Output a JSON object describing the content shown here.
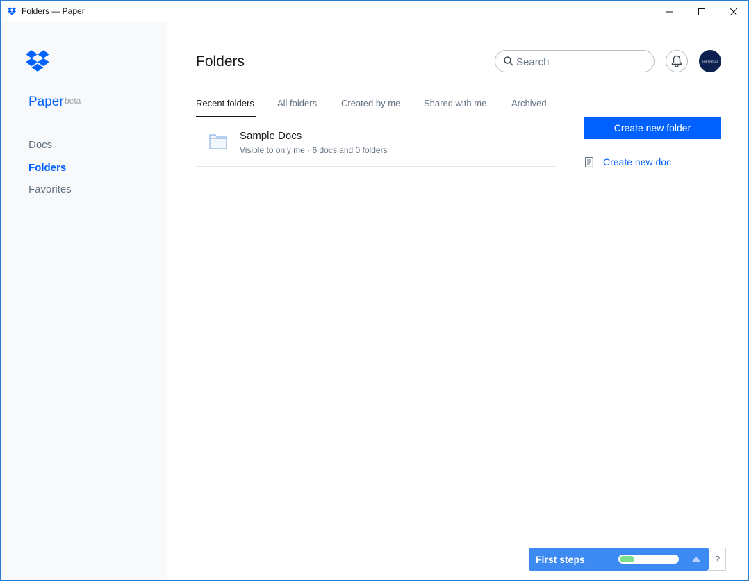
{
  "window": {
    "title": "Folders — Paper",
    "controls": [
      "minimize",
      "maximize",
      "close"
    ]
  },
  "sidebar": {
    "brand": "Paper",
    "brand_tag": "beta",
    "items": [
      {
        "label": "Docs",
        "active": false
      },
      {
        "label": "Folders",
        "active": true
      },
      {
        "label": "Favorites",
        "active": false
      }
    ]
  },
  "header": {
    "title": "Folders",
    "search": {
      "placeholder": "Search",
      "value": ""
    },
    "avatar_text": "SOFTPEDIA"
  },
  "tabs": [
    {
      "label": "Recent folders",
      "active": true
    },
    {
      "label": "All folders",
      "active": false
    },
    {
      "label": "Created by me",
      "active": false
    },
    {
      "label": "Shared with me",
      "active": false
    },
    {
      "label": "Archived",
      "active": false
    }
  ],
  "folders": [
    {
      "name": "Sample Docs",
      "meta": "Visible to only me · 6 docs and 0 folders"
    }
  ],
  "actions": {
    "create_folder": "Create new folder",
    "create_doc": "Create new doc"
  },
  "first_steps": {
    "label": "First steps",
    "progress": 0.25,
    "help": "?"
  },
  "colors": {
    "accent": "#0061fe",
    "first_steps_bg": "#3d8bf2",
    "progress_fill": "#7ee08f",
    "avatar_bg": "#0d2151"
  }
}
